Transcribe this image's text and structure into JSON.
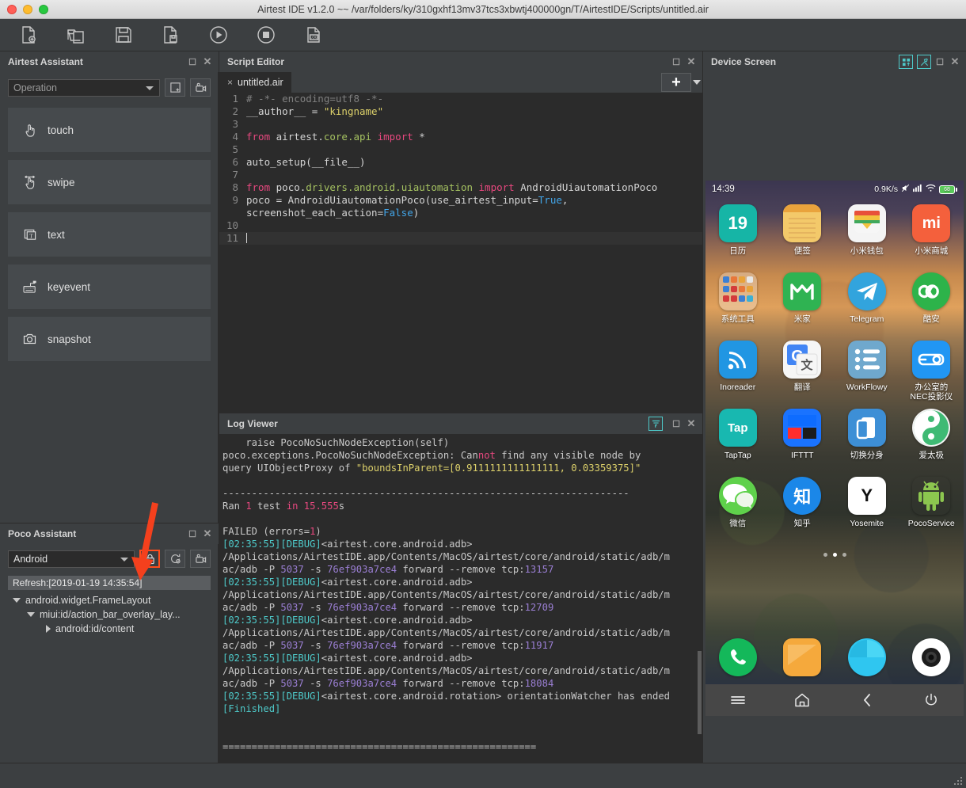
{
  "window": {
    "title": "Airtest IDE v1.2.0 ~~ /var/folders/ky/310gxhf13mv37tcs3xbwtj400000gn/T/AirtestIDE/Scripts/untitled.air"
  },
  "toolbar": {
    "buttons": [
      {
        "name": "new-script-button",
        "icon": "new-file-icon",
        "tooltip": "New Script"
      },
      {
        "name": "open-script-button",
        "icon": "open-folder-icon",
        "tooltip": "Open Script"
      },
      {
        "name": "save-script-button",
        "icon": "save-floppy-icon",
        "tooltip": "Save Script"
      },
      {
        "name": "save-as-button",
        "icon": "save-as-icon",
        "tooltip": "Save As"
      },
      {
        "name": "run-button",
        "icon": "play-circle-icon",
        "tooltip": "Run Script"
      },
      {
        "name": "stop-button",
        "icon": "stop-circle-icon",
        "tooltip": "Stop Script"
      },
      {
        "name": "view-log-button",
        "icon": "log-file-icon",
        "tooltip": "View Report"
      }
    ]
  },
  "airtest_assistant": {
    "title": "Airtest Assistant",
    "mode_select": {
      "value": "Operation"
    },
    "toolbar_buttons": [
      {
        "name": "screenshot-tool-button",
        "icon": "screenshot-icon"
      },
      {
        "name": "record-tool-button",
        "icon": "camera-record-icon"
      }
    ],
    "operations": [
      {
        "label": "touch",
        "icon": "touch-hand-icon"
      },
      {
        "label": "swipe",
        "icon": "swipe-hand-icon"
      },
      {
        "label": "text",
        "icon": "text-box-icon"
      },
      {
        "label": "keyevent",
        "icon": "keyboard-icon"
      },
      {
        "label": "snapshot",
        "icon": "camera-icon"
      }
    ]
  },
  "poco_assistant": {
    "title": "Poco Assistant",
    "mode_select": {
      "value": "Android"
    },
    "toolbar_buttons": [
      {
        "name": "lock-ui-tree-button",
        "icon": "lock-icon",
        "highlighted": true
      },
      {
        "name": "refresh-ui-tree-button",
        "icon": "refresh-icon",
        "highlighted": false
      },
      {
        "name": "record-poco-button",
        "icon": "camera-record-icon",
        "highlighted": false
      }
    ],
    "refresh_label": "Refresh:[2019-01-19 14:35:54]",
    "tree": [
      {
        "label": "android.widget.FrameLayout",
        "depth": 0,
        "expanded": true
      },
      {
        "label": "miui:id/action_bar_overlay_lay...",
        "depth": 1,
        "expanded": true
      },
      {
        "label": "android:id/content",
        "depth": 2,
        "expanded": false
      }
    ],
    "annotation": {
      "name": "red-arrow-annotation",
      "color": "#f4401d"
    }
  },
  "script_editor": {
    "title": "Script Editor",
    "tab": {
      "label": "untitled.air",
      "close": "×"
    },
    "add_tab_button": "+",
    "code_lines": [
      {
        "n": 1,
        "tokens": [
          {
            "t": "# -*- encoding=utf8 -*-",
            "c": "c-com"
          }
        ]
      },
      {
        "n": 2,
        "tokens": [
          {
            "t": "__author__ = ",
            "c": "c-def"
          },
          {
            "t": "\"kingname\"",
            "c": "c-str"
          }
        ]
      },
      {
        "n": 3,
        "tokens": []
      },
      {
        "n": 4,
        "tokens": [
          {
            "t": "from ",
            "c": "c-kw2"
          },
          {
            "t": "airtest.",
            "c": "c-def"
          },
          {
            "t": "core.api",
            "c": "c-attr"
          },
          {
            "t": " import ",
            "c": "c-kw2"
          },
          {
            "t": "*",
            "c": "c-def"
          }
        ]
      },
      {
        "n": 5,
        "tokens": []
      },
      {
        "n": 6,
        "tokens": [
          {
            "t": "auto_setup(__file__)",
            "c": "c-def"
          }
        ]
      },
      {
        "n": 7,
        "tokens": []
      },
      {
        "n": 8,
        "tokens": [
          {
            "t": "from ",
            "c": "c-kw2"
          },
          {
            "t": "poco.",
            "c": "c-def"
          },
          {
            "t": "drivers.android.uiautomation",
            "c": "c-attr"
          },
          {
            "t": " import ",
            "c": "c-kw2"
          },
          {
            "t": "AndroidUiautomationPoco",
            "c": "c-def"
          }
        ]
      },
      {
        "n": 9,
        "tokens": [
          {
            "t": "poco = AndroidUiautomationPoco(use_airtest_input=",
            "c": "c-def"
          },
          {
            "t": "True",
            "c": "c-blue"
          },
          {
            "t": ",",
            "c": "c-def"
          }
        ]
      },
      {
        "n": "",
        "tokens": [
          {
            "t": "screenshot_each_action=",
            "c": "c-def"
          },
          {
            "t": "False",
            "c": "c-blue"
          },
          {
            "t": ")",
            "c": "c-def"
          }
        ]
      },
      {
        "n": 10,
        "tokens": []
      },
      {
        "n": 11,
        "tokens": [],
        "current": true
      }
    ]
  },
  "log_viewer": {
    "title": "Log Viewer",
    "filter_button": {
      "name": "filter-button",
      "icon": "filter-funnel-icon"
    },
    "lines": [
      [
        {
          "t": "    raise PocoNoSuchNodeException(self)",
          "c": ""
        }
      ],
      [
        {
          "t": "poco.exceptions.PocoNoSuchNodeException: Can",
          "c": ""
        },
        {
          "t": "not",
          "c": "lg-pink"
        },
        {
          "t": " find any visible node by",
          "c": ""
        }
      ],
      [
        {
          "t": "query UIObjectProxy of ",
          "c": ""
        },
        {
          "t": "\"boundsInParent=[0.9111111111111111, 0.03359375]\"",
          "c": "lg-yellow"
        }
      ],
      [
        {
          "t": "",
          "c": ""
        }
      ],
      [
        {
          "t": "----------------------------------------------------------------------",
          "c": ""
        }
      ],
      [
        {
          "t": "Ran ",
          "c": ""
        },
        {
          "t": "1",
          "c": "lg-pink"
        },
        {
          "t": " test ",
          "c": ""
        },
        {
          "t": "in",
          "c": "lg-pink"
        },
        {
          "t": " ",
          "c": ""
        },
        {
          "t": "15.555",
          "c": "lg-pink"
        },
        {
          "t": "s",
          "c": ""
        }
      ],
      [
        {
          "t": "",
          "c": ""
        }
      ],
      [
        {
          "t": "FAILED (errors=",
          "c": ""
        },
        {
          "t": "1",
          "c": "lg-pink"
        },
        {
          "t": ")",
          "c": ""
        }
      ],
      [
        {
          "t": "[02:35:55][DEBUG]",
          "c": "lg-time"
        },
        {
          "t": "<airtest.core.android.adb>",
          "c": ""
        }
      ],
      [
        {
          "t": "/Applications/AirtestIDE.app/Contents/MacOS/airtest/core/android/static/adb/m",
          "c": ""
        }
      ],
      [
        {
          "t": "ac/adb -P ",
          "c": ""
        },
        {
          "t": "5037",
          "c": "lg-num"
        },
        {
          "t": " -s ",
          "c": ""
        },
        {
          "t": "76ef903a7ce4",
          "c": "lg-num"
        },
        {
          "t": " forward --remove tcp:",
          "c": ""
        },
        {
          "t": "13157",
          "c": "lg-num"
        }
      ],
      [
        {
          "t": "[02:35:55][DEBUG]",
          "c": "lg-time"
        },
        {
          "t": "<airtest.core.android.adb>",
          "c": ""
        }
      ],
      [
        {
          "t": "/Applications/AirtestIDE.app/Contents/MacOS/airtest/core/android/static/adb/m",
          "c": ""
        }
      ],
      [
        {
          "t": "ac/adb -P ",
          "c": ""
        },
        {
          "t": "5037",
          "c": "lg-num"
        },
        {
          "t": " -s ",
          "c": ""
        },
        {
          "t": "76ef903a7ce4",
          "c": "lg-num"
        },
        {
          "t": " forward --remove tcp:",
          "c": ""
        },
        {
          "t": "12709",
          "c": "lg-num"
        }
      ],
      [
        {
          "t": "[02:35:55][DEBUG]",
          "c": "lg-time"
        },
        {
          "t": "<airtest.core.android.adb>",
          "c": ""
        }
      ],
      [
        {
          "t": "/Applications/AirtestIDE.app/Contents/MacOS/airtest/core/android/static/adb/m",
          "c": ""
        }
      ],
      [
        {
          "t": "ac/adb -P ",
          "c": ""
        },
        {
          "t": "5037",
          "c": "lg-num"
        },
        {
          "t": " -s ",
          "c": ""
        },
        {
          "t": "76ef903a7ce4",
          "c": "lg-num"
        },
        {
          "t": " forward --remove tcp:",
          "c": ""
        },
        {
          "t": "11917",
          "c": "lg-num"
        }
      ],
      [
        {
          "t": "[02:35:55][DEBUG]",
          "c": "lg-time"
        },
        {
          "t": "<airtest.core.android.adb>",
          "c": ""
        }
      ],
      [
        {
          "t": "/Applications/AirtestIDE.app/Contents/MacOS/airtest/core/android/static/adb/m",
          "c": ""
        }
      ],
      [
        {
          "t": "ac/adb -P ",
          "c": ""
        },
        {
          "t": "5037",
          "c": "lg-num"
        },
        {
          "t": " -s ",
          "c": ""
        },
        {
          "t": "76ef903a7ce4",
          "c": "lg-num"
        },
        {
          "t": " forward --remove tcp:",
          "c": ""
        },
        {
          "t": "18084",
          "c": "lg-num"
        }
      ],
      [
        {
          "t": "[02:35:55][DEBUG]",
          "c": "lg-time"
        },
        {
          "t": "<airtest.core.android.rotation> orientationWatcher has ended",
          "c": ""
        }
      ],
      [
        {
          "t": "[Finished]",
          "c": "lg-time"
        }
      ],
      [
        {
          "t": "",
          "c": ""
        }
      ],
      [
        {
          "t": "",
          "c": ""
        }
      ],
      [
        {
          "t": "======================================================",
          "c": ""
        }
      ]
    ]
  },
  "device_screen": {
    "title": "Device Screen",
    "toolbar_buttons": [
      {
        "name": "device-layout-button",
        "icon": "grid-arrow-icon"
      },
      {
        "name": "device-tools-button",
        "icon": "tools-icon"
      }
    ],
    "status_bar": {
      "time": "14:39",
      "network_speed": "0.9K/s",
      "icons": [
        "mute-icon",
        "signal-icon",
        "wifi-icon",
        "battery-icon"
      ],
      "battery_level": "68"
    },
    "home_rows": [
      [
        {
          "label": "日历",
          "icon": "calendar-icon",
          "glyph": "19",
          "bg": "#16b5a6",
          "shape": "sq",
          "fg": "#ffffff"
        },
        {
          "label": "便签",
          "icon": "notes-icon",
          "glyph": "",
          "bg": "#f3c96a",
          "shape": "sq",
          "fg": "#ffffff"
        },
        {
          "label": "小米钱包",
          "icon": "mi-wallet-icon",
          "glyph": "",
          "bg": "#f4f4f4",
          "shape": "sq",
          "fg": "#333333"
        },
        {
          "label": "小米商城",
          "icon": "mi-store-icon",
          "glyph": "mi",
          "bg": "#f4603c",
          "shape": "sq",
          "fg": "#ffffff"
        }
      ],
      [
        {
          "label": "系统工具",
          "icon": "system-tools-folder-icon",
          "glyph": "",
          "bg": "rgba(255,255,255,0.30)",
          "shape": "sq",
          "fg": "#ffffff"
        },
        {
          "label": "米家",
          "icon": "mijia-icon",
          "glyph": "",
          "bg": "#2fb352",
          "shape": "sq",
          "fg": "#ffffff"
        },
        {
          "label": "Telegram",
          "icon": "telegram-icon",
          "glyph": "",
          "bg": "#32a4dd",
          "shape": "round",
          "fg": "#ffffff"
        },
        {
          "label": "酷安",
          "icon": "coolapk-icon",
          "glyph": "",
          "bg": "#2db34a",
          "shape": "round",
          "fg": "#ffffff"
        }
      ],
      [
        {
          "label": "Inoreader",
          "icon": "inoreader-icon",
          "glyph": "",
          "bg": "#2196e3",
          "shape": "sq",
          "fg": "#ffffff"
        },
        {
          "label": "翻译",
          "icon": "google-translate-icon",
          "glyph": "G",
          "bg": "#f6f6f6",
          "shape": "sq",
          "fg": "#4285f4"
        },
        {
          "label": "WorkFlowy",
          "icon": "workflowy-icon",
          "glyph": "",
          "bg": "#6fa8cd",
          "shape": "sq",
          "fg": "#ffffff"
        },
        {
          "label": "办公室的\nNEC投影仪",
          "icon": "projector-shortcut-icon",
          "glyph": "",
          "bg": "#2196f3",
          "shape": "sq",
          "fg": "#ffffff"
        }
      ],
      [
        {
          "label": "TapTap",
          "icon": "taptap-icon",
          "glyph": "Tap",
          "bg": "#18b8b0",
          "shape": "sq",
          "fg": "#ffffff"
        },
        {
          "label": "IFTTT",
          "icon": "ifttt-icon",
          "glyph": "",
          "bg": "#1a73ff",
          "shape": "sq",
          "fg": "#ffffff"
        },
        {
          "label": "切换分身",
          "icon": "second-space-icon",
          "glyph": "",
          "bg": "#3d8fd6",
          "shape": "sq",
          "fg": "#ffffff"
        },
        {
          "label": "爱太极",
          "icon": "aitaiji-icon",
          "glyph": "",
          "bg": "#f2f2f2",
          "shape": "round",
          "fg": "#2fb36a"
        }
      ],
      [
        {
          "label": "微信",
          "icon": "wechat-icon",
          "glyph": "",
          "bg": "#5fd14b",
          "shape": "round",
          "fg": "#ffffff"
        },
        {
          "label": "知乎",
          "icon": "zhihu-icon",
          "glyph": "知",
          "bg": "#1b87e8",
          "shape": "round",
          "fg": "#ffffff"
        },
        {
          "label": "Yosemite",
          "icon": "yosemite-icon",
          "glyph": "Y",
          "bg": "#ffffff",
          "shape": "sq",
          "fg": "#111111"
        },
        {
          "label": "PocoService",
          "icon": "android-robot-icon",
          "glyph": "",
          "bg": "transparent",
          "shape": "sq",
          "fg": "#8cc64f"
        }
      ]
    ],
    "page_dots": {
      "count": 3,
      "active": 1
    },
    "dock": [
      {
        "label": "",
        "icon": "phone-icon",
        "bg": "#14b85a",
        "shape": "round",
        "fg": "#ffffff"
      },
      {
        "label": "",
        "icon": "messages-icon",
        "bg": "#f5a93c",
        "shape": "sq",
        "fg": "#ffffff"
      },
      {
        "label": "",
        "icon": "browser-icon",
        "bg": "#2fc6f0",
        "shape": "round",
        "fg": "#ffffff"
      },
      {
        "label": "",
        "icon": "camera-icon",
        "bg": "#ffffff",
        "shape": "round",
        "fg": "#1a1a1a"
      }
    ],
    "nav_bar": [
      {
        "name": "nav-menu-button",
        "icon": "menu-icon"
      },
      {
        "name": "nav-home-button",
        "icon": "home-icon"
      },
      {
        "name": "nav-back-button",
        "icon": "back-chevron-icon"
      },
      {
        "name": "nav-power-button",
        "icon": "power-icon"
      }
    ]
  },
  "colors": {
    "panel_bg": "#3c3f41",
    "editor_bg": "#2b2b2b",
    "accent_teal": "#4ec9c9",
    "annotation_red": "#f4401d"
  }
}
